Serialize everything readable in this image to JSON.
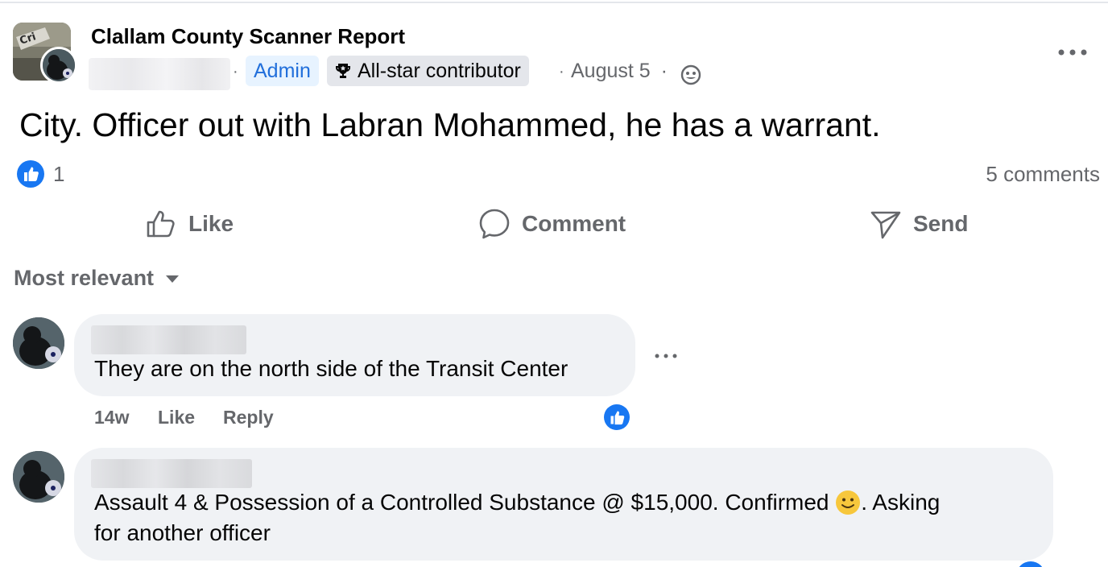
{
  "post": {
    "group_name": "Clallam County Scanner Report",
    "author_name_redacted": "",
    "admin_badge": "Admin",
    "allstar_badge": "All-star contributor",
    "separator": "·",
    "date": "August 5",
    "text": "City. Officer out with Labran Mohammed, he has a warrant.",
    "reaction_count": "1",
    "comments_count": "5 comments"
  },
  "actions": {
    "like": "Like",
    "comment": "Comment",
    "send": "Send"
  },
  "sort_label": "Most relevant",
  "comments": [
    {
      "text": "They are on the north side of the Transit Center",
      "age": "14w",
      "like_label": "Like",
      "reply_label": "Reply"
    },
    {
      "text_before_emoji": "Assault 4 & Possession of a Controlled Substance @ $15,000. Confirmed ",
      "text_after_emoji": ". Asking",
      "text_line2": "for another officer"
    }
  ],
  "colors": {
    "accent": "#1877f2",
    "secondary_text": "#65676b",
    "bubble": "#f0f2f5",
    "admin_badge_bg": "#e7f3ff",
    "admin_badge_text": "#216fdb"
  },
  "icons": [
    "trophy-icon",
    "globe-icon",
    "more-icon",
    "like-icon",
    "comment-icon",
    "send-icon",
    "caret-down-icon",
    "emoji-icon"
  ]
}
